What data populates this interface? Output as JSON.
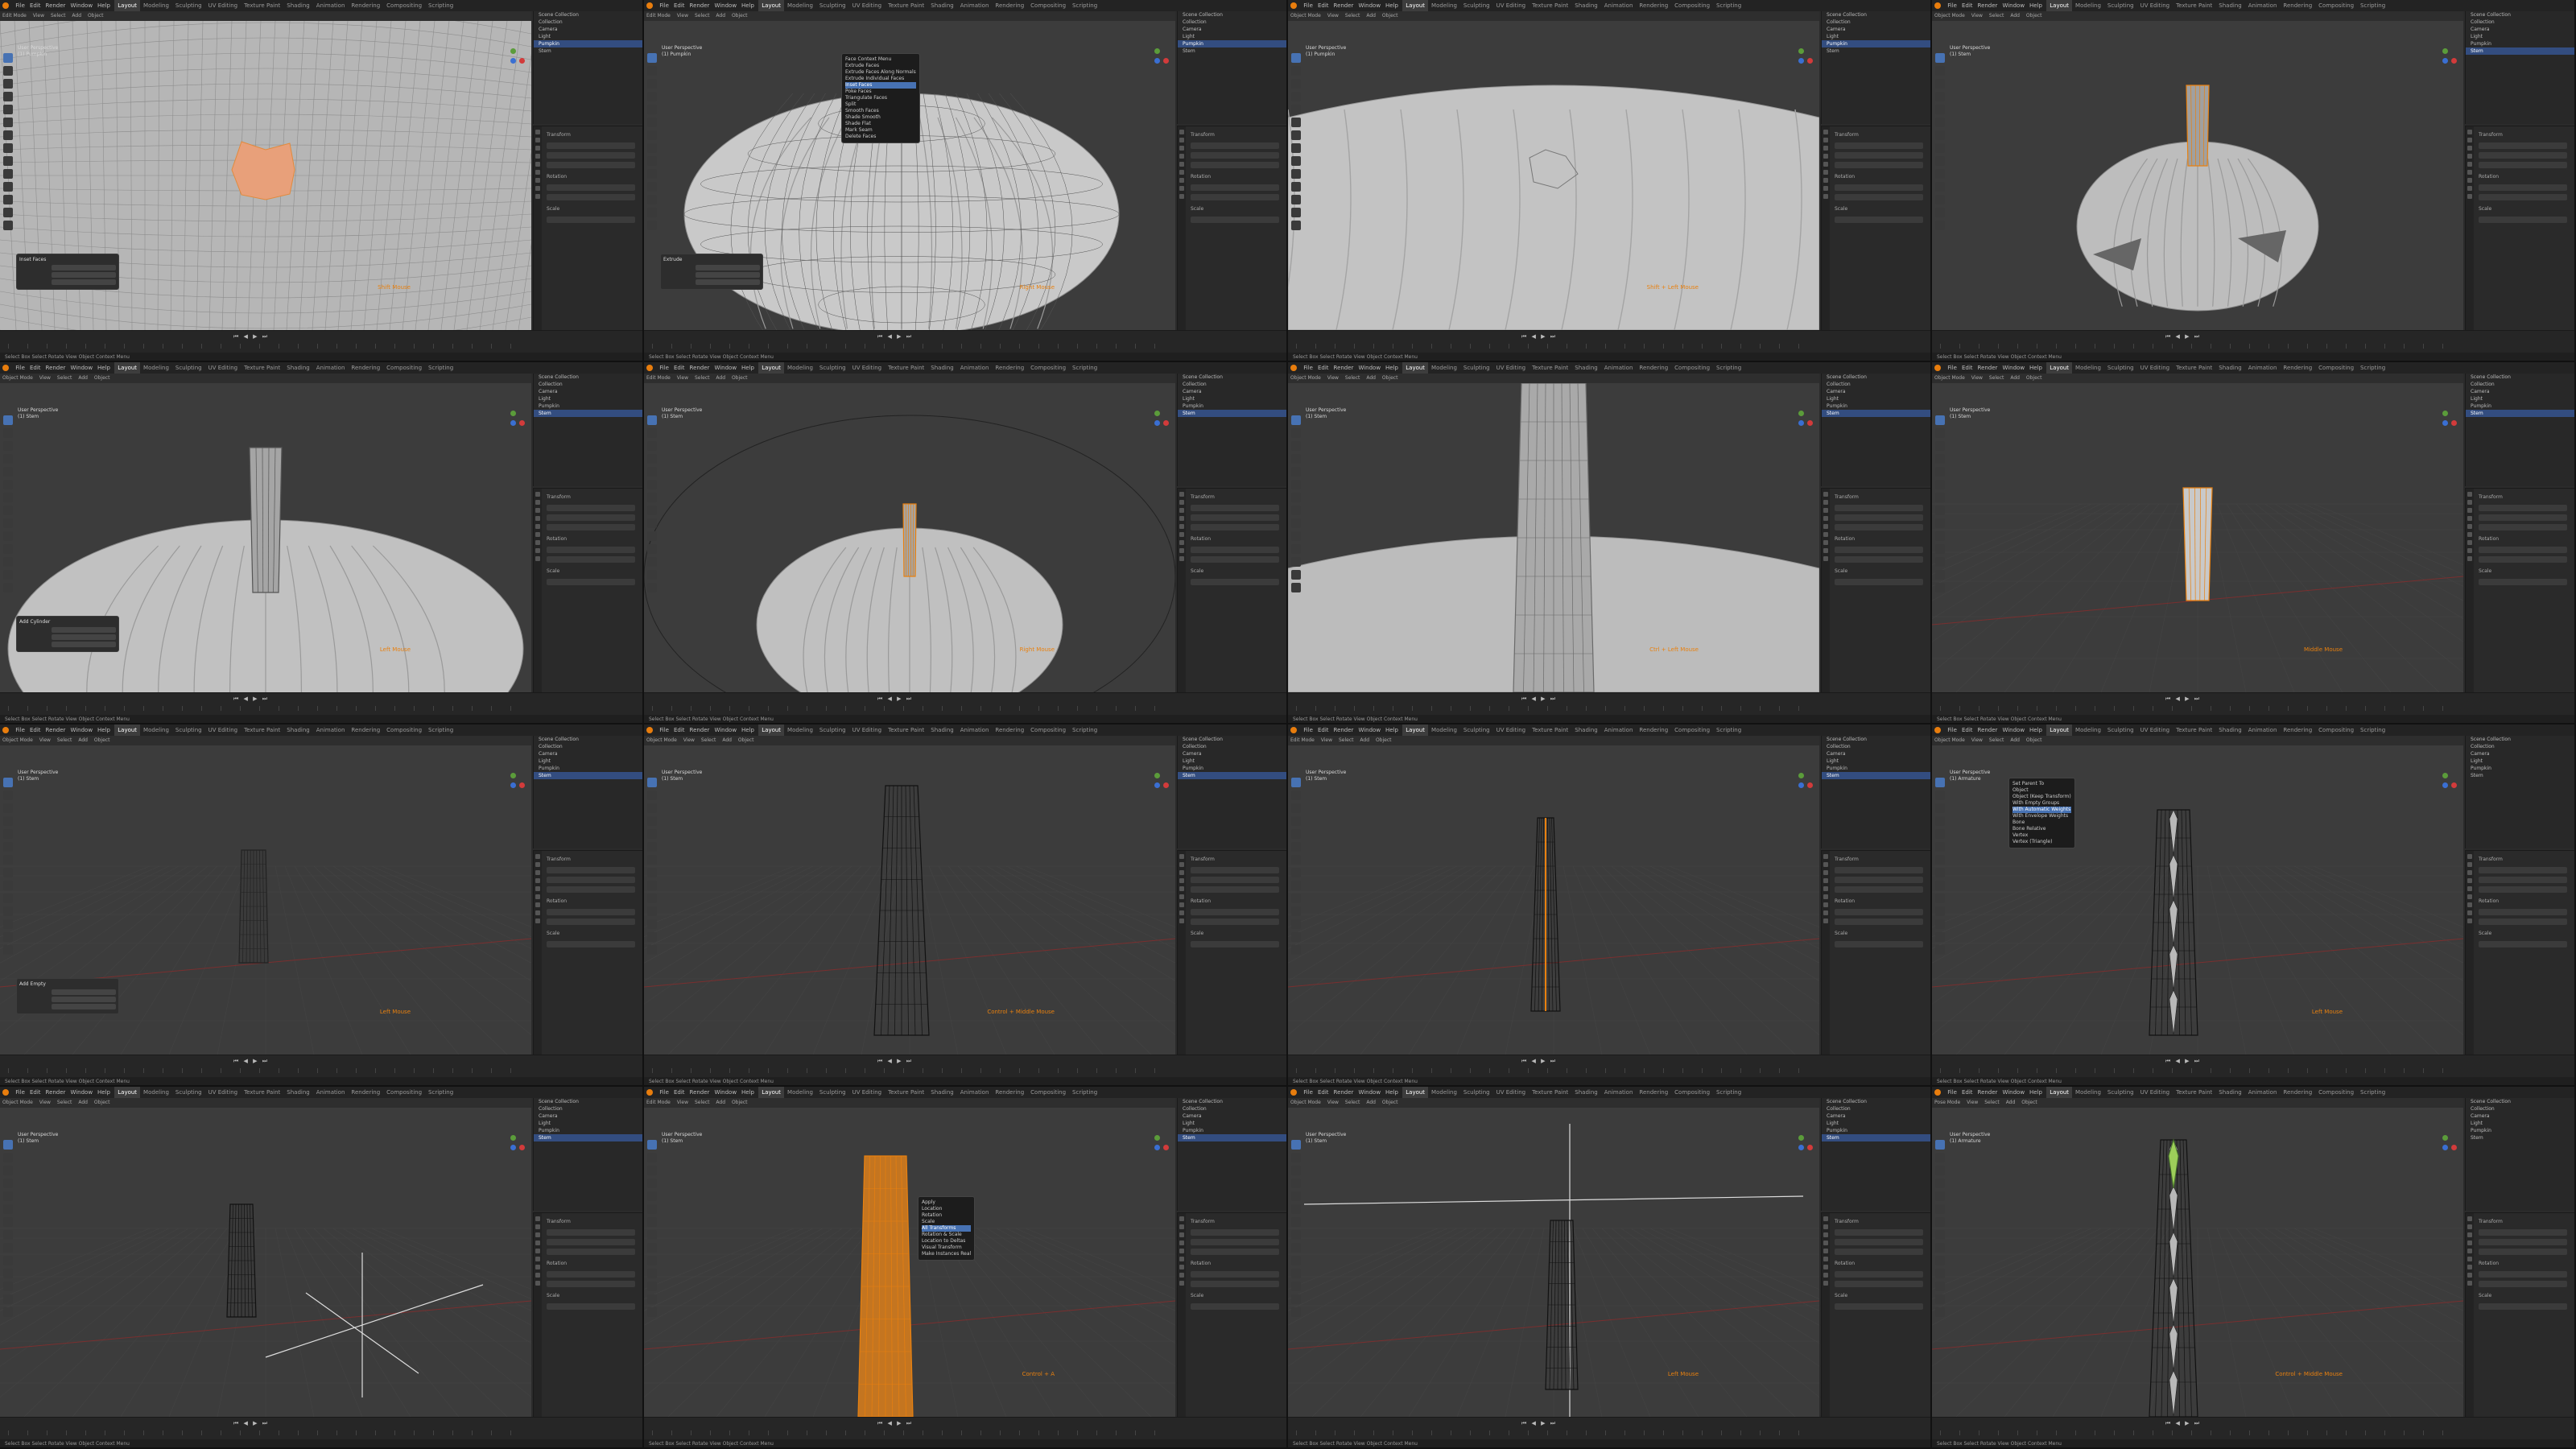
{
  "app": {
    "menu": [
      "File",
      "Edit",
      "Render",
      "Window",
      "Help"
    ],
    "workspaces": [
      "Layout",
      "Modeling",
      "Sculpting",
      "UV Editing",
      "Texture Paint",
      "Shading",
      "Animation",
      "Rendering",
      "Compositing",
      "Scripting"
    ],
    "active_workspace": "Layout"
  },
  "panels": [
    {
      "view": "User Perspective",
      "obj": "(1) Pumpkin",
      "mode": "Edit Mode",
      "shape": "grid-face",
      "key": "Shift Mouse",
      "popup": null,
      "op": "Inset Faces"
    },
    {
      "view": "User Perspective",
      "obj": "(1) Pumpkin",
      "mode": "Edit Mode",
      "shape": "pumpkin-wire",
      "key": "Right Mouse",
      "popup": "face-menu",
      "op": "Extrude"
    },
    {
      "view": "User Perspective",
      "obj": "(1) Pumpkin",
      "mode": "Object Mode",
      "shape": "pumpkin-top",
      "key": "Shift + Left Mouse",
      "popup": null,
      "op": null
    },
    {
      "view": "User Perspective",
      "obj": "(1) Stem",
      "mode": "Object Mode",
      "shape": "pumpkin-carved",
      "key": "",
      "popup": null,
      "op": null
    },
    {
      "view": "User Perspective",
      "obj": "(1) Stem",
      "mode": "Object Mode",
      "shape": "pumpkin-stem",
      "key": "Left Mouse",
      "popup": null,
      "op": "Add Cylinder"
    },
    {
      "view": "User Perspective",
      "obj": "(1) Stem",
      "mode": "Edit Mode",
      "shape": "pumpkin-circle",
      "key": "Right Mouse",
      "popup": null,
      "op": null
    },
    {
      "view": "User Perspective",
      "obj": "(1) Stem",
      "mode": "Object Mode",
      "shape": "stem-close",
      "key": "Ctrl + Left Mouse",
      "popup": null,
      "op": null
    },
    {
      "view": "User Perspective",
      "obj": "(1) Stem",
      "mode": "Object Mode",
      "shape": "stem-alone",
      "key": "Middle Mouse",
      "popup": null,
      "op": null
    },
    {
      "view": "User Perspective",
      "obj": "(1) Stem",
      "mode": "Object Mode",
      "shape": "stem-grid",
      "key": "Left Mouse",
      "popup": null,
      "op": "Add Empty"
    },
    {
      "view": "User Perspective",
      "obj": "(1) Stem",
      "mode": "Object Mode",
      "shape": "stem-wire",
      "key": "Control + Middle Mouse",
      "popup": null,
      "op": null
    },
    {
      "view": "User Perspective",
      "obj": "(1) Stem",
      "mode": "Edit Mode",
      "shape": "stem-orange-edges",
      "key": "",
      "popup": null,
      "op": null
    },
    {
      "view": "User Perspective",
      "obj": "(1) Armature",
      "mode": "Object Mode",
      "shape": "stem-bones",
      "key": "Left Mouse",
      "popup": "parent-menu",
      "op": null
    },
    {
      "view": "User Perspective",
      "obj": "(1) Stem",
      "mode": "Object Mode",
      "shape": "stem-empty-axes",
      "key": "",
      "popup": null,
      "op": null
    },
    {
      "view": "User Perspective",
      "obj": "(1) Stem",
      "mode": "Edit Mode",
      "shape": "stem-orange-full",
      "key": "Control + A",
      "popup": "apply-menu",
      "op": null
    },
    {
      "view": "User Perspective",
      "obj": "(1) Stem",
      "mode": "Object Mode",
      "shape": "stem-tilt",
      "key": "Left Mouse",
      "popup": null,
      "op": null
    },
    {
      "view": "User Perspective",
      "obj": "(1) Armature",
      "mode": "Pose Mode",
      "shape": "stem-bones-tall",
      "key": "Control + Middle Mouse",
      "popup": null,
      "op": null
    }
  ],
  "outliner_items": [
    "Scene Collection",
    "Collection",
    "Camera",
    "Light",
    "Pumpkin",
    "Stem"
  ],
  "status": "Select    Box Select    Rotate View    Object Context Menu",
  "colors": {
    "accent": "#e8800f",
    "select": "#4772b3",
    "mesh": "#b8b8b8"
  }
}
